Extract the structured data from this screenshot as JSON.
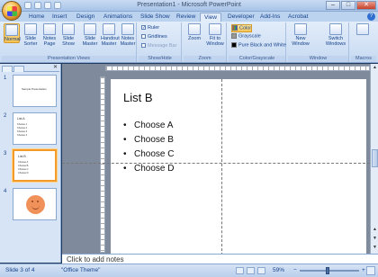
{
  "window": {
    "title": "Presentation1 - Microsoft PowerPoint",
    "controls": [
      "–",
      "□",
      "✕"
    ]
  },
  "tabs": [
    "Home",
    "Insert",
    "Design",
    "Animations",
    "Slide Show",
    "Review",
    "View",
    "Developer",
    "Add-Ins",
    "Acrobat"
  ],
  "active_tab": "View",
  "ribbon": {
    "presentation_views": {
      "label": "Presentation Views",
      "buttons": [
        "Normal",
        "Slide Sorter",
        "Notes Page",
        "Slide Show",
        "Slide Master",
        "Handout Master",
        "Notes Master"
      ]
    },
    "show_hide": {
      "label": "Show/Hide",
      "ruler": "Ruler",
      "gridlines": "Gridlines",
      "message_bar": "Message Bar"
    },
    "zoom": {
      "label": "Zoom",
      "zoom_button": "Zoom",
      "fit_button": "Fit to Window"
    },
    "color_grayscale": {
      "label": "Color/Grayscale",
      "options": [
        "Color",
        "Grayscale",
        "Pure Black and White"
      ]
    },
    "window": {
      "label": "Window",
      "new_window": "New Window",
      "switch_windows": "Switch Windows"
    },
    "macros": {
      "label": "Macros",
      "button": "Macros"
    }
  },
  "slides": [
    {
      "num": "1",
      "title": "Sample Presentation"
    },
    {
      "num": "2",
      "title": "List A",
      "items": [
        "Choose 1",
        "Choose 2",
        "Choose 3",
        "Choose 4"
      ]
    },
    {
      "num": "3",
      "title": "List B",
      "items": [
        "Choose A",
        "Choose B",
        "Choose C",
        "Choose D"
      ]
    },
    {
      "num": "4",
      "title": ""
    }
  ],
  "current_slide": {
    "title": "List B",
    "bullets": [
      "Choose A",
      "Choose B",
      "Choose C",
      "Choose D"
    ]
  },
  "notes_placeholder": "Click to add notes",
  "status": {
    "slide_info": "Slide 3 of 4",
    "theme": "\"Office Theme\"",
    "zoom": "59%"
  }
}
